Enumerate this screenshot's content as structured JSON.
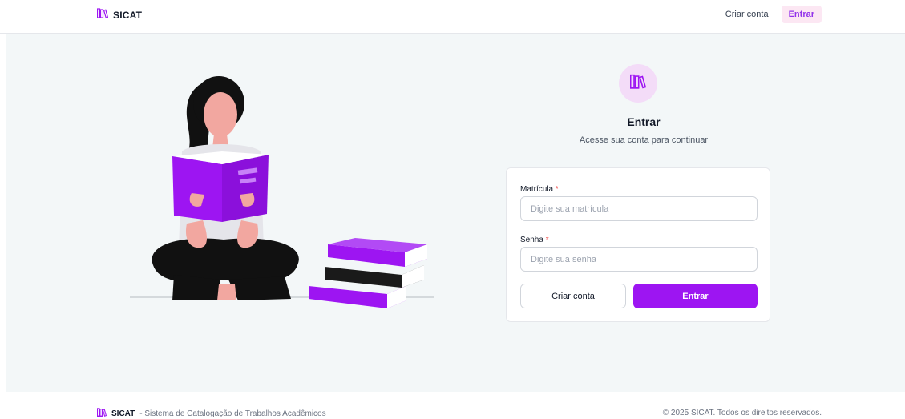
{
  "header": {
    "brand_name": "SICAT",
    "brand_icon": "books-icon",
    "nav": {
      "signup_label": "Criar conta",
      "login_label": "Entrar"
    }
  },
  "login": {
    "title": "Entrar",
    "subtitle": "Acesse sua conta para continuar",
    "matricula": {
      "label": "Matrícula",
      "required_mark": "*",
      "placeholder": "Digite sua matrícula",
      "value": ""
    },
    "senha": {
      "label": "Senha",
      "required_mark": "*",
      "placeholder": "Digite sua senha",
      "value": ""
    },
    "secondary_button": "Criar conta",
    "primary_button": "Entrar"
  },
  "footer": {
    "brand_name": "SICAT",
    "tagline": "- Sistema de Catalogação de Trabalhos Acadêmicos",
    "copyright": "© 2025 SICAT. Todos os direitos reservados."
  },
  "colors": {
    "accent": "#9d15f2",
    "accent_soft": "#fce7f3",
    "logo_bg": "#f3dcf8",
    "page_bg": "#f3f7f8",
    "required": "#ef4444"
  }
}
